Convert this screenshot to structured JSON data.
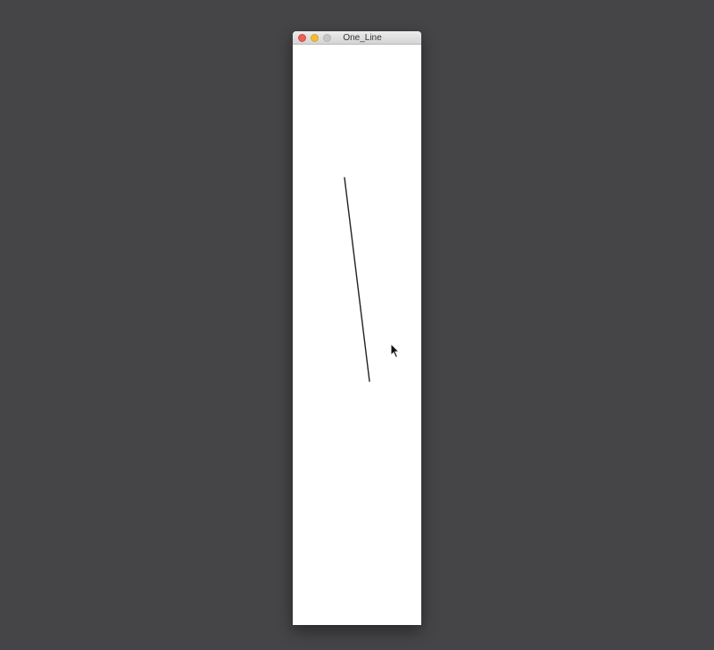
{
  "window": {
    "title": "One_Line"
  },
  "icons": {
    "close": "close-dot",
    "minimize": "minimize-dot",
    "zoom": "zoom-dot",
    "cursor": "arrow-cursor"
  },
  "colors": {
    "desktop": "#454547",
    "canvas": "#ffffff",
    "line": "#222222",
    "close": "#ec5f57",
    "minimize": "#f3bd3b",
    "zoom": "#c7c7c7"
  }
}
